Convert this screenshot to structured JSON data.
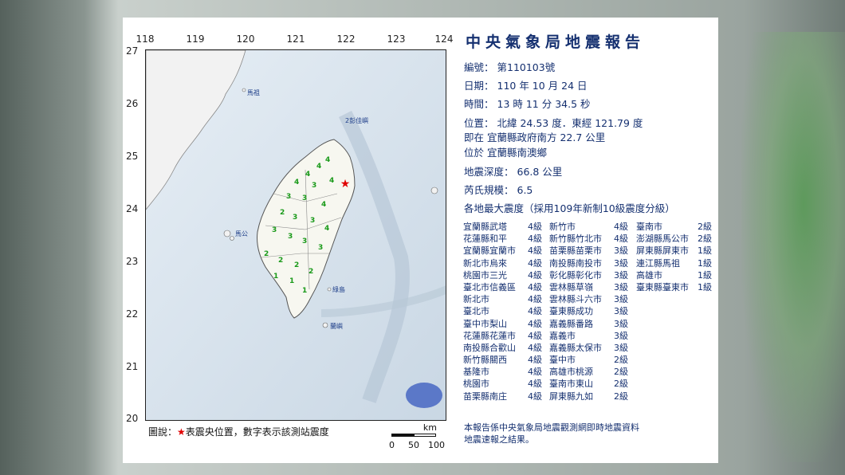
{
  "report": {
    "title": "中央氣象局地震報告",
    "number_label": "編號：",
    "number": "第110103號",
    "date_label": "日期：",
    "date": "110 年 10 月 24 日",
    "time_label": "時間：",
    "time": "13 時 11 分 34.5 秒",
    "position_label": "位置：",
    "position": "北緯 24.53 度．東經 121.79 度",
    "location_line1": "即在 宜蘭縣政府南方 22.7 公里",
    "location_line2": "位於 宜蘭縣南澳鄉",
    "depth_label": "地震深度：",
    "depth": "66.8 公里",
    "magnitude_label": "芮氏規模：",
    "magnitude": "6.5",
    "intensity_heading": "各地最大震度（採用109年新制10級震度分級）",
    "footer_line1": "本報告係中央氣象局地震觀測網即時地震資料",
    "footer_line2": "地震速報之結果。"
  },
  "intensity": {
    "col1": [
      {
        "loc": "宜蘭縣武塔",
        "lvl": "4級"
      },
      {
        "loc": "花蓮縣和平",
        "lvl": "4級"
      },
      {
        "loc": "宜蘭縣宜蘭市",
        "lvl": "4級"
      },
      {
        "loc": "新北市烏來",
        "lvl": "4級"
      },
      {
        "loc": "桃園市三光",
        "lvl": "4級"
      },
      {
        "loc": "臺北市信義區",
        "lvl": "4級"
      },
      {
        "loc": "新北市",
        "lvl": "4級"
      },
      {
        "loc": "臺北市",
        "lvl": "4級"
      },
      {
        "loc": "臺中市梨山",
        "lvl": "4級"
      },
      {
        "loc": "花蓮縣花蓮市",
        "lvl": "4級"
      },
      {
        "loc": "南投縣合歡山",
        "lvl": "4級"
      },
      {
        "loc": "新竹縣關西",
        "lvl": "4級"
      },
      {
        "loc": "基隆市",
        "lvl": "4級"
      },
      {
        "loc": "桃園市",
        "lvl": "4級"
      },
      {
        "loc": "苗栗縣南庄",
        "lvl": "4級"
      }
    ],
    "col2": [
      {
        "loc": "新竹市",
        "lvl": "4級"
      },
      {
        "loc": "新竹縣竹北市",
        "lvl": "4級"
      },
      {
        "loc": "苗栗縣苗栗市",
        "lvl": "3級"
      },
      {
        "loc": "南投縣南投市",
        "lvl": "3級"
      },
      {
        "loc": "彰化縣彰化市",
        "lvl": "3級"
      },
      {
        "loc": "雲林縣草嶺",
        "lvl": "3級"
      },
      {
        "loc": "雲林縣斗六市",
        "lvl": "3級"
      },
      {
        "loc": "臺東縣成功",
        "lvl": "3級"
      },
      {
        "loc": "嘉義縣番路",
        "lvl": "3級"
      },
      {
        "loc": "嘉義市",
        "lvl": "3級"
      },
      {
        "loc": "嘉義縣太保市",
        "lvl": "3級"
      },
      {
        "loc": "臺中市",
        "lvl": "2級"
      },
      {
        "loc": "高雄市桃源",
        "lvl": "2級"
      },
      {
        "loc": "臺南市東山",
        "lvl": "2級"
      },
      {
        "loc": "屏東縣九如",
        "lvl": "2級"
      }
    ],
    "col3": [
      {
        "loc": "臺南市",
        "lvl": "2級"
      },
      {
        "loc": "澎湖縣馬公市",
        "lvl": "2級"
      },
      {
        "loc": "屏東縣屏東市",
        "lvl": "1級"
      },
      {
        "loc": "連江縣馬祖",
        "lvl": "1級"
      },
      {
        "loc": "高雄市",
        "lvl": "1級"
      },
      {
        "loc": "臺東縣臺東市",
        "lvl": "1級"
      }
    ]
  },
  "map": {
    "lon_ticks": [
      "118",
      "119",
      "120",
      "121",
      "122",
      "123",
      "124"
    ],
    "lat_ticks": [
      "27",
      "26",
      "25",
      "24",
      "23",
      "22",
      "21",
      "20"
    ],
    "legend_prefix": "圖說：",
    "legend_star": "★",
    "legend_text": "表震央位置，數字表示該測站震度",
    "scale_unit": "km",
    "scale_0": "0",
    "scale_50": "50",
    "scale_100": "100",
    "place_matsu": "馬祖",
    "place_pengyu": "2彭佳嶼",
    "place_penghu": "馬公",
    "place_ludao": "綠島",
    "place_lanyu": "蘭嶼",
    "epicenter_color": "#e00000",
    "station_color": "#1a9a1a"
  }
}
